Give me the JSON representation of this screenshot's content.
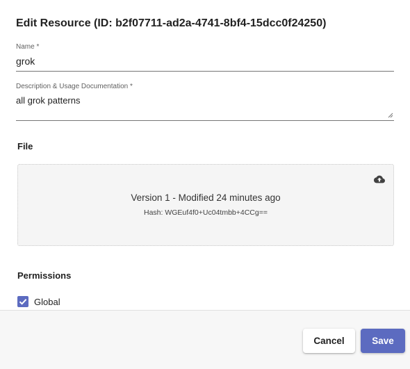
{
  "dialog": {
    "title": "Edit Resource (ID: b2f07711-ad2a-4741-8bf4-15dcc0f24250)"
  },
  "fields": {
    "name": {
      "label": "Name *",
      "value": "grok"
    },
    "description": {
      "label": "Description & Usage Documentation *",
      "value": "all grok patterns"
    }
  },
  "file_section": {
    "heading": "File",
    "version_text": "Version 1 - Modified 24 minutes ago",
    "hash_text": "Hash: WGEuf4f0+Uc04tmbb+4CCg==",
    "upload_icon": "cloud-upload-icon"
  },
  "permissions": {
    "heading": "Permissions",
    "global": {
      "label": "Global",
      "checked": true
    }
  },
  "footer": {
    "cancel_label": "Cancel",
    "save_label": "Save"
  },
  "colors": {
    "accent": "#5c6bc0",
    "dropzone_bg": "#f5f5f5",
    "footer_bg": "#f7f7f7"
  }
}
